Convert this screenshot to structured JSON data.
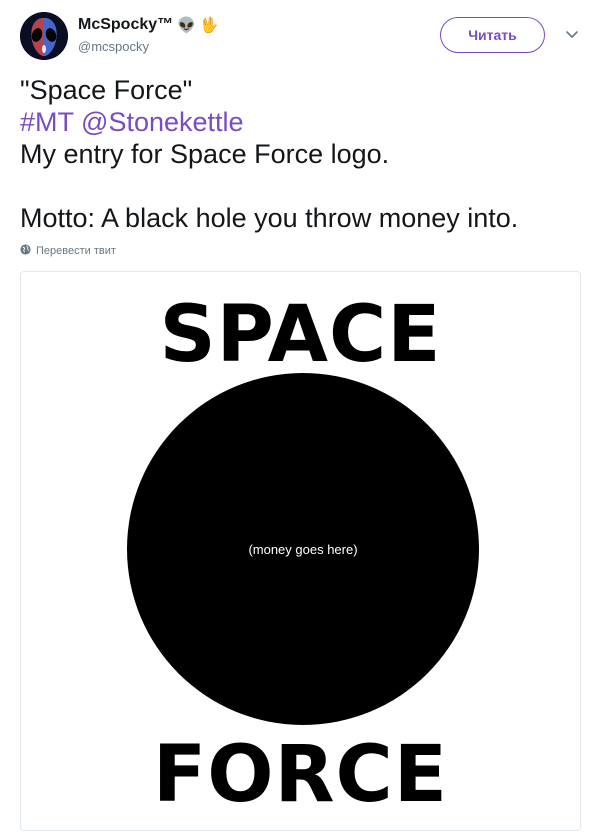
{
  "user": {
    "display_name": "McSpocky™",
    "emoji_alien": "👽",
    "emoji_vulcan": "🖖",
    "handle": "@mcspocky"
  },
  "follow_button": {
    "label": "Читать"
  },
  "tweet": {
    "line1": "\"Space Force\"",
    "hashtag": "#MT",
    "mention": "@Stonekettle",
    "line3": "My entry for Space Force logo.",
    "line5": "Motto: A black hole you throw money into."
  },
  "translate": {
    "label": "Перевести твит"
  },
  "media": {
    "top_word": "SPACE",
    "circle_text": "(money goes here)",
    "bottom_word": "FORCE"
  },
  "colors": {
    "accent": "#794bc4",
    "text": "#14171a",
    "muted": "#657786",
    "border": "#e1e8ed"
  },
  "icons": [
    "avatar-image",
    "chevron-down-icon",
    "globe-icon"
  ]
}
